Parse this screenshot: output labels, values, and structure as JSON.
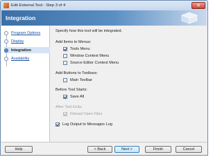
{
  "window": {
    "title": "Edit External Tool - Step 3 of 4",
    "close_symbol": "✕"
  },
  "header": {
    "title": "Integration"
  },
  "steps": [
    {
      "label": "Program Options",
      "state": "visited"
    },
    {
      "label": "Display",
      "state": "visited"
    },
    {
      "label": "Integration",
      "state": "current"
    },
    {
      "label": "Availability",
      "state": "pending"
    }
  ],
  "content": {
    "description": "Specify how this tool will be integrated.",
    "menus_heading": "Add Items to Menus:",
    "menu_options": [
      {
        "label": "Tools Menu",
        "checked": true
      },
      {
        "label": "Window Context Menu",
        "checked": false
      },
      {
        "label": "Source Editor Context Menu",
        "checked": false
      }
    ],
    "toolbars_heading": "Add Buttons to Toolbars:",
    "toolbar_options": [
      {
        "label": "Main Toolbar",
        "checked": false
      }
    ],
    "before_heading": "Before Tool Starts:",
    "before_options": [
      {
        "label": "Save All",
        "checked": true
      }
    ],
    "after_heading": "After Tool Exits:",
    "after_options": [
      {
        "label": "Reload Open Files",
        "checked": true,
        "disabled": true
      }
    ],
    "log_option": {
      "label": "Log Output to Messages Log",
      "checked": true
    }
  },
  "buttons": {
    "help": "Help",
    "back": "< Back",
    "next": "Next >",
    "finish": "Finish",
    "cancel": "Cancel"
  },
  "colors": {
    "header_start": "#3a6ea6",
    "header_end": "#c9d9ec",
    "link": "#1a52a8",
    "current_step_bg": "#d5e3f4"
  }
}
